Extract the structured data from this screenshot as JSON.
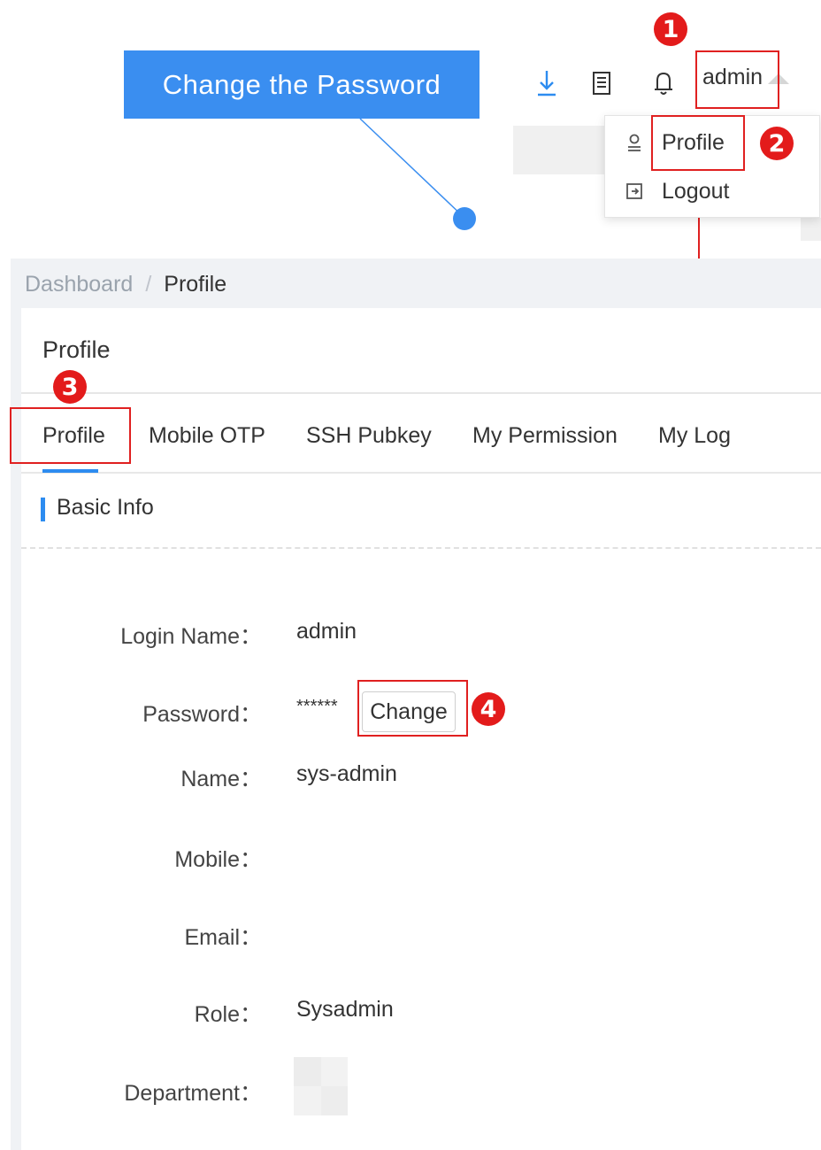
{
  "callout": {
    "text": "Change the Password"
  },
  "header": {
    "user_name": "admin",
    "icons": [
      "download-icon",
      "document-icon",
      "bell-icon",
      "caret-up-icon"
    ]
  },
  "dropdown": {
    "items": [
      {
        "label": "Profile",
        "icon": "user-icon"
      },
      {
        "label": "Logout",
        "icon": "logout-icon"
      }
    ]
  },
  "badges": [
    "1",
    "2",
    "3",
    "4"
  ],
  "breadcrumb": {
    "home": "Dashboard",
    "separator": "/",
    "current": "Profile"
  },
  "card": {
    "title": "Profile"
  },
  "tabs": [
    {
      "label": "Profile",
      "active": true
    },
    {
      "label": "Mobile OTP"
    },
    {
      "label": "SSH Pubkey"
    },
    {
      "label": "My Permission"
    },
    {
      "label": "My Log"
    }
  ],
  "section": {
    "title": "Basic Info"
  },
  "fields": {
    "login_name": {
      "label": "Login Name：",
      "value": "admin"
    },
    "password": {
      "label": "Password：",
      "value": "******",
      "button": "Change"
    },
    "name": {
      "label": "Name：",
      "value": "sys-admin"
    },
    "mobile": {
      "label": "Mobile：",
      "value": ""
    },
    "email": {
      "label": "Email：",
      "value": ""
    },
    "role": {
      "label": "Role：",
      "value": "Sysadmin"
    },
    "department": {
      "label": "Department："
    }
  },
  "colors": {
    "accent": "#2d8cf0",
    "callout": "#3a8ef0",
    "annotation_red": "#e02020"
  }
}
